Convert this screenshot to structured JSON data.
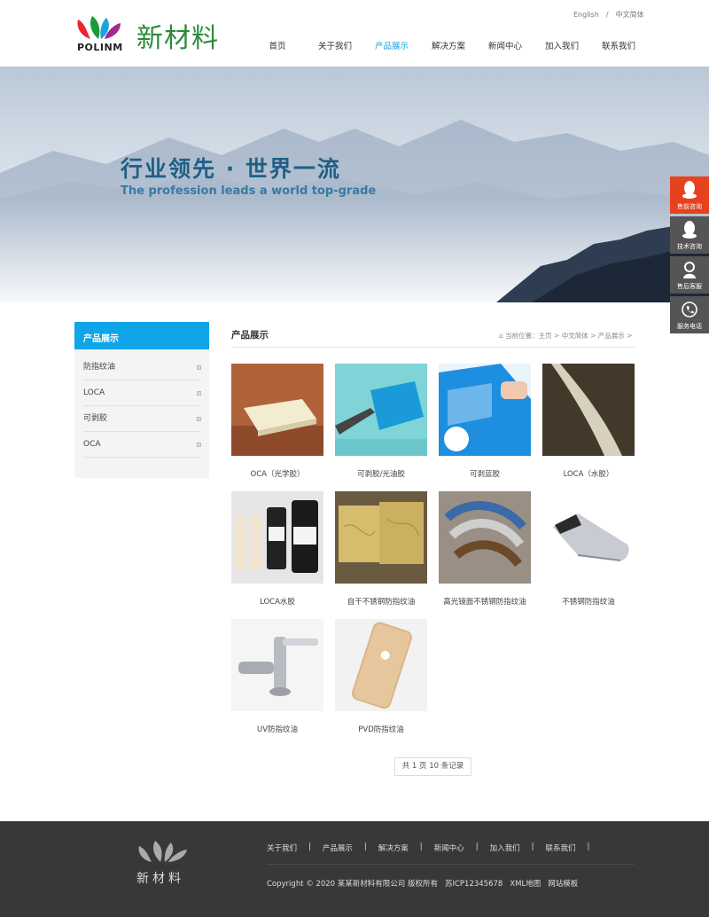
{
  "header": {
    "logo_text": "POLINM",
    "brand_name": "新材料",
    "lang": {
      "en": "English",
      "sep": "/",
      "cn": "中文简体"
    },
    "nav": [
      "首页",
      "关于我们",
      "产品展示",
      "解决方案",
      "新闻中心",
      "加入我们",
      "联系我们"
    ],
    "active_nav": "产品展示"
  },
  "banner": {
    "title": "行业领先 · 世界一流",
    "subtitle": "The profession leads a world top-grade"
  },
  "sidebar": {
    "title": "产品展示",
    "items": [
      "防指纹油",
      "LOCA",
      "可剥胶",
      "OCA"
    ]
  },
  "main": {
    "title": "产品展示",
    "breadcrumb": "当前位置：主页 > 中文简体 > 产品展示 >",
    "products": [
      {
        "name": "OCA（光学胶）"
      },
      {
        "name": "可剥胶/光油胶"
      },
      {
        "name": "可剥蓝胶"
      },
      {
        "name": "LOCA（水胶）"
      },
      {
        "name": "LOCA水胶"
      },
      {
        "name": "自干不锈钢防指纹油"
      },
      {
        "name": "高光镜面不锈钢防指纹油"
      },
      {
        "name": "不锈钢防指纹油"
      },
      {
        "name": "UV防指纹油"
      },
      {
        "name": "PVD防指纹油"
      }
    ],
    "pager": "共 1 页 10 条记录"
  },
  "float_bar": {
    "items": [
      "售前咨询",
      "技术咨询",
      "售后客服",
      "服务电话"
    ]
  },
  "footer": {
    "brand": "新材料",
    "nav": [
      "关于我们",
      "产品展示",
      "解决方案",
      "新闻中心",
      "加入我们",
      "联系我们"
    ],
    "sep": "|",
    "copyright": "Copyright © 2020 某某新材料有限公司 版权所有",
    "icp": "苏ICP12345678",
    "sitemap": "XML地图",
    "template": "网站模板"
  },
  "colors": {
    "accent": "#10a5e8",
    "brand_green": "#2c8a3c",
    "float_red": "#e8411e",
    "footer_bg": "#383838"
  }
}
